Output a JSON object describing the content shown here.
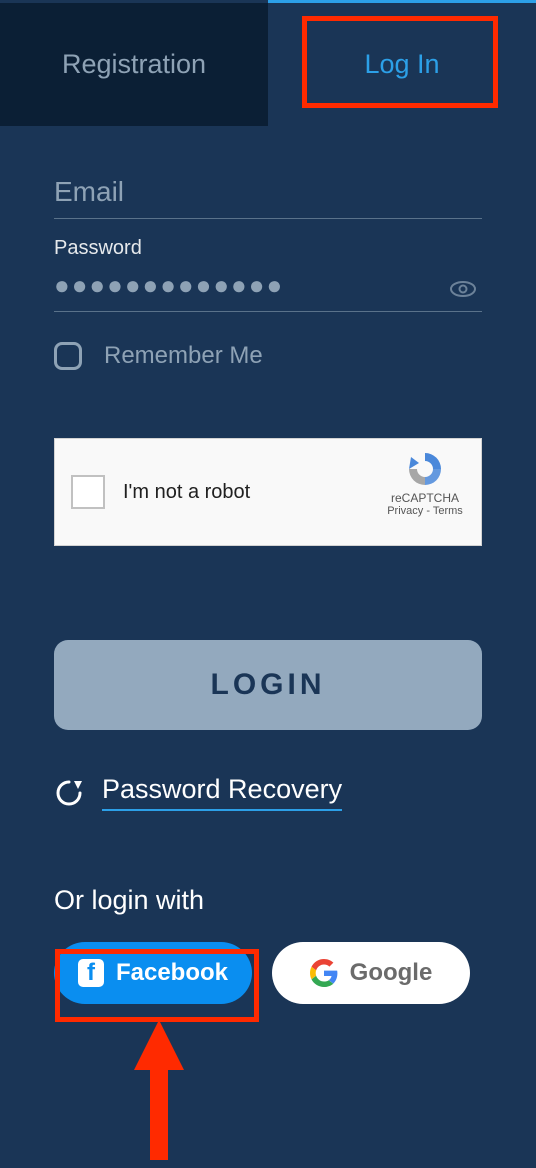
{
  "tabs": {
    "registration": "Registration",
    "login": "Log In"
  },
  "form": {
    "email_placeholder": "Email",
    "password_label": "Password",
    "password_value": "●●●●●●●●●●●●●",
    "remember_label": "Remember Me"
  },
  "recaptcha": {
    "text": "I'm not a robot",
    "name": "reCAPTCHA",
    "privacy": "Privacy",
    "terms": "Terms"
  },
  "buttons": {
    "login": "LOGIN",
    "recovery": "Password Recovery",
    "or_login": "Or login with",
    "facebook": "Facebook",
    "google": "Google"
  }
}
